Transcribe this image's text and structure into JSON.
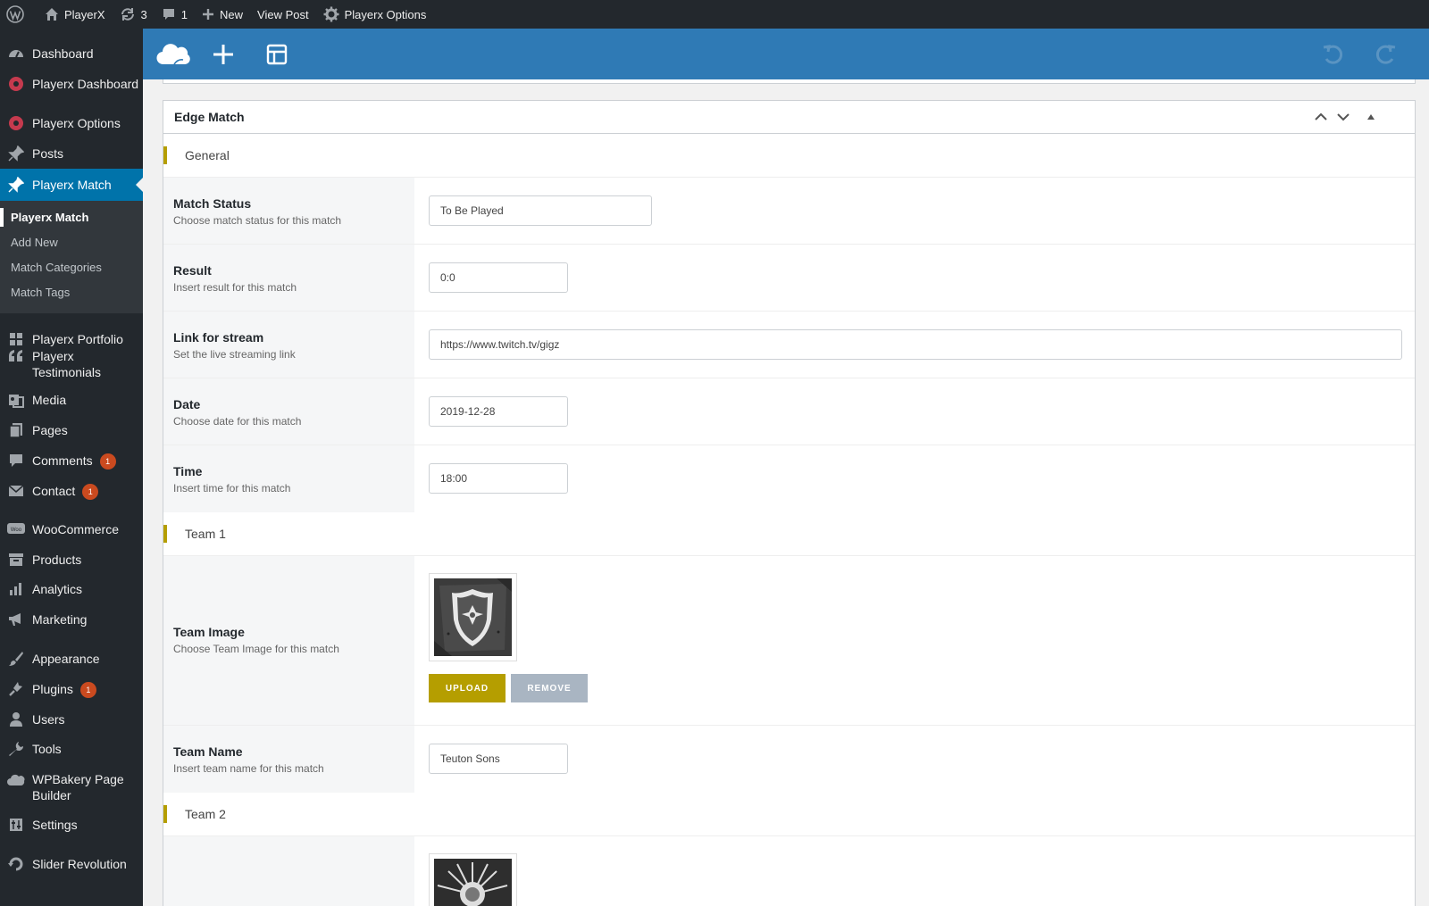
{
  "adminbar": {
    "site_name": "PlayerX",
    "updates_count": "3",
    "comments_count": "1",
    "new_label": "New",
    "view_post_label": "View Post",
    "options_label": "Playerx Options"
  },
  "sidebar": {
    "items": [
      {
        "label": "Dashboard",
        "icon": "dashboard-icon"
      },
      {
        "label": "Playerx Dashboard",
        "icon": "playerx-icon"
      },
      {
        "label": "Playerx Options",
        "icon": "playerx-icon"
      },
      {
        "label": "Posts",
        "icon": "pin-icon"
      },
      {
        "label": "Playerx Match",
        "icon": "pin-icon",
        "active": true
      },
      {
        "label": "Playerx Portfolio",
        "icon": "grid-icon"
      },
      {
        "label": "Playerx Testimonials",
        "label_line1": "Playerx",
        "label_line2": "Testimonials",
        "icon": "quote-icon"
      },
      {
        "label": "Media",
        "icon": "media-icon"
      },
      {
        "label": "Pages",
        "icon": "pages-icon"
      },
      {
        "label": "Comments",
        "icon": "comment-icon",
        "badge": "1"
      },
      {
        "label": "Contact",
        "icon": "mail-icon",
        "badge": "1"
      },
      {
        "label": "WooCommerce",
        "icon": "woo-icon"
      },
      {
        "label": "Products",
        "icon": "products-icon"
      },
      {
        "label": "Analytics",
        "icon": "analytics-icon"
      },
      {
        "label": "Marketing",
        "icon": "megaphone-icon"
      },
      {
        "label": "Appearance",
        "icon": "brush-icon"
      },
      {
        "label": "Plugins",
        "icon": "plugin-icon",
        "badge": "1"
      },
      {
        "label": "Users",
        "icon": "users-icon"
      },
      {
        "label": "Tools",
        "icon": "wrench-icon"
      },
      {
        "label": "WPBakery Page Builder",
        "label_line1": "WPBakery Page",
        "label_line2": "Builder",
        "icon": "cloud-icon"
      },
      {
        "label": "Settings",
        "icon": "settings-icon"
      },
      {
        "label": "Slider Revolution",
        "icon": "refresh-icon"
      }
    ],
    "submenu": [
      "Playerx Match",
      "Add New",
      "Match Categories",
      "Match Tags"
    ]
  },
  "metabox": {
    "title": "Edge Match",
    "sections": {
      "general": "General",
      "team1": "Team 1",
      "team2": "Team 2"
    },
    "fields": {
      "status": {
        "label": "Match Status",
        "desc": "Choose match status for this match",
        "value": "To Be Played"
      },
      "result": {
        "label": "Result",
        "desc": "Insert result for this match",
        "value": "0:0"
      },
      "stream": {
        "label": "Link for stream",
        "desc": "Set the live streaming link",
        "value": "https://www.twitch.tv/gigz"
      },
      "date": {
        "label": "Date",
        "desc": "Choose date for this match",
        "value": "2019-12-28"
      },
      "time": {
        "label": "Time",
        "desc": "Insert time for this match",
        "value": "18:00"
      },
      "team_image": {
        "label": "Team Image",
        "desc": "Choose Team Image for this match"
      },
      "team_name": {
        "label": "Team Name",
        "desc": "Insert team name for this match",
        "value": "Teuton Sons"
      }
    },
    "upload_label": "UPLOAD",
    "remove_label": "REMOVE"
  },
  "colors": {
    "accent": "#b59e00",
    "toolbar": "#2f7ab5",
    "sidebar": "#23282d",
    "active_menu": "#0073aa",
    "badge": "#ca4a1f"
  }
}
